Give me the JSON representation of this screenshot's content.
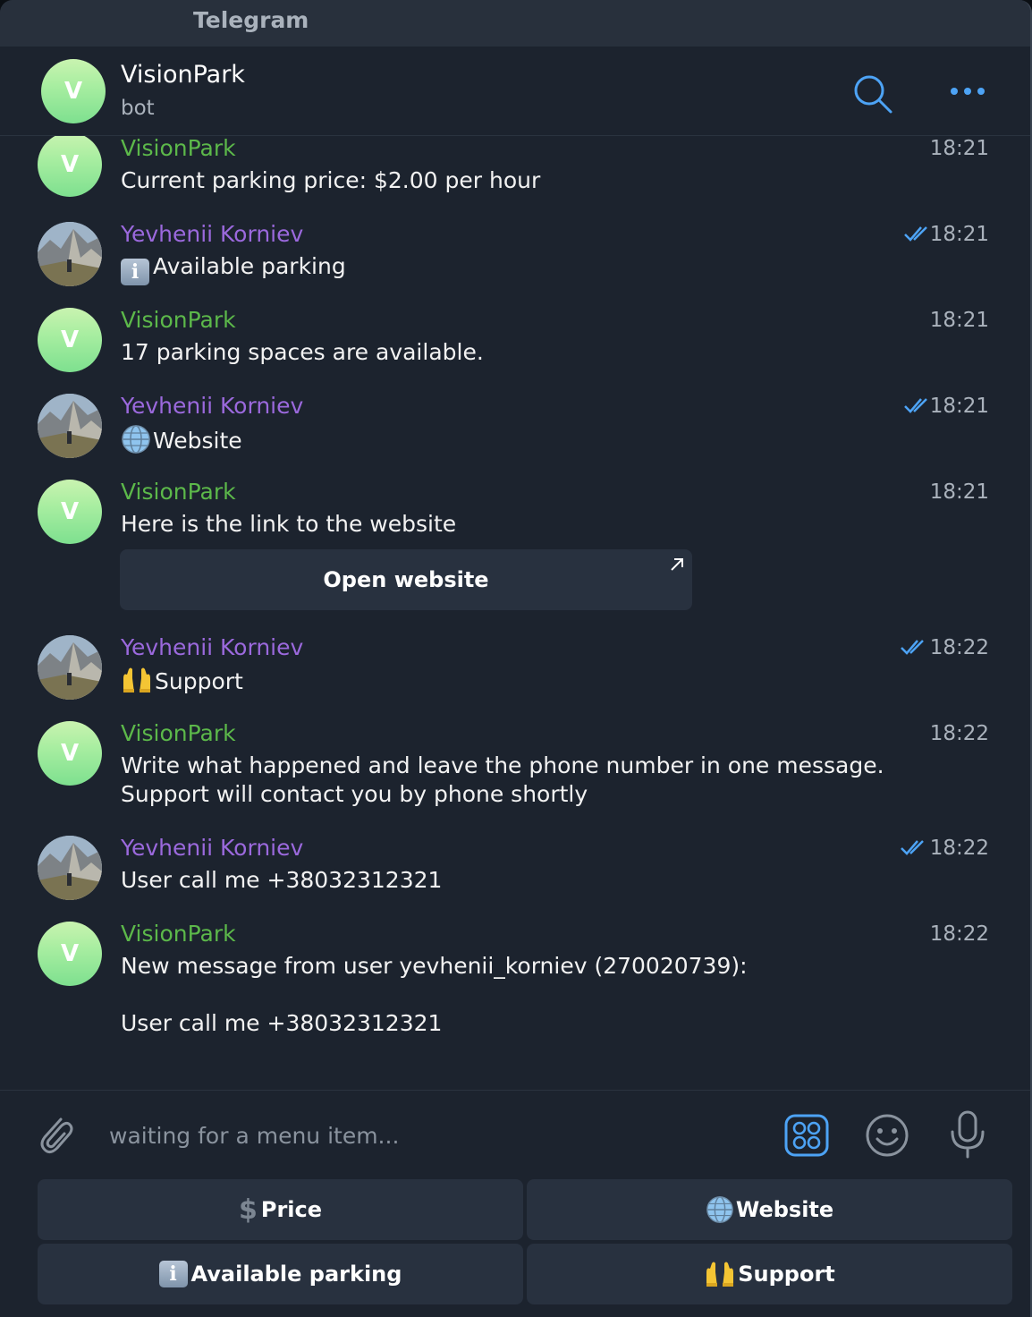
{
  "window": {
    "title": "Telegram"
  },
  "chat": {
    "avatar_letter": "V",
    "name": "VisionPark",
    "status": "bot",
    "icons": {
      "search": "search-icon",
      "more": "more-dots-icon"
    }
  },
  "colors": {
    "bot_name": "#5cb84a",
    "user_name": "#9b69dd",
    "accent": "#4da3f5",
    "background": "#1c232e",
    "button": "#28313f"
  },
  "messages": [
    {
      "sender": "VisionPark",
      "time": "18:21",
      "text": "Current parking price: $2.00 per hour"
    },
    {
      "sender": "Yevhenii Korniev",
      "time": "18:21",
      "emoji": "information-emoji",
      "text": "Available parking",
      "read": true
    },
    {
      "sender": "VisionPark",
      "time": "18:21",
      "text": "17 parking spaces are available."
    },
    {
      "sender": "Yevhenii Korniev",
      "time": "18:21",
      "emoji": "globe-emoji",
      "text": "Website",
      "read": true
    },
    {
      "sender": "VisionPark",
      "time": "18:21",
      "text": "Here is the link to the website",
      "button": "Open website"
    },
    {
      "sender": "Yevhenii Korniev",
      "time": "18:22",
      "emoji": "raised-hands-emoji",
      "text": "Support",
      "read": true
    },
    {
      "sender": "VisionPark",
      "time": "18:22",
      "text": "Write what happened and leave the phone number in one message.\nSupport will contact you by phone shortly"
    },
    {
      "sender": "Yevhenii Korniev",
      "time": "18:22",
      "text": "User call me +38032312321",
      "read": true
    },
    {
      "sender": "VisionPark",
      "time": "18:22",
      "text": "New message from user yevhenii_korniev (270020739):\n\nUser call me +38032312321"
    }
  ],
  "composer": {
    "placeholder": "waiting for a menu item...",
    "icons": [
      "paperclip-icon",
      "bot-keyboard-icon",
      "emoji-smile-icon",
      "microphone-icon"
    ]
  },
  "keyboard": {
    "price": {
      "label": "Price",
      "emoji": "dollar-sign-emoji"
    },
    "website": {
      "label": "Website",
      "emoji": "globe-emoji"
    },
    "available": {
      "label": "Available parking",
      "emoji": "information-emoji"
    },
    "support": {
      "label": "Support",
      "emoji": "raised-hands-emoji"
    }
  }
}
